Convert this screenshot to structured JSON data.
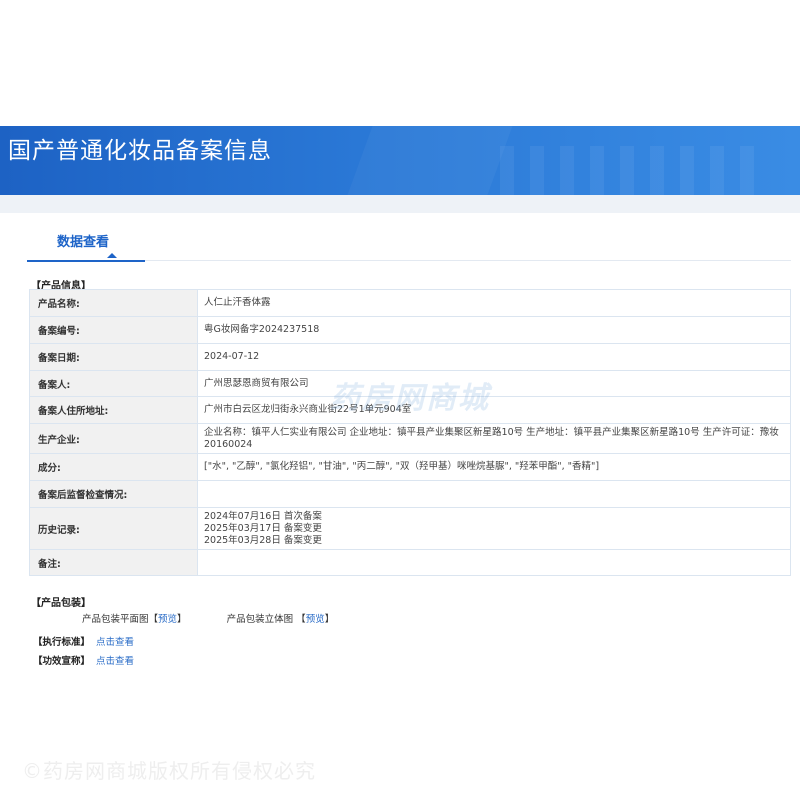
{
  "banner": {
    "title": "国产普通化妆品备案信息"
  },
  "tabs": {
    "active_label": "数据查看"
  },
  "product_info": {
    "section_label": "【产品信息】",
    "rows": [
      {
        "key": "产品名称:",
        "value": "人仁止汗香体露"
      },
      {
        "key": "备案编号:",
        "value": "粤G妆网备字2024237518"
      },
      {
        "key": "备案日期:",
        "value": "2024-07-12"
      },
      {
        "key": "备案人:",
        "value": "广州思瑟恩商贸有限公司"
      },
      {
        "key": "备案人住所地址:",
        "value": "广州市白云区龙归街永兴商业街22号1单元904室"
      },
      {
        "key": "生产企业:",
        "value": "企业名称：镇平人仁实业有限公司 企业地址：镇平县产业集聚区新星路10号 生产地址：镇平县产业集聚区新星路10号 生产许可证：豫妆20160024"
      },
      {
        "key": "成分:",
        "value": "[\"水\", \"乙醇\", \"氯化羟铝\", \"甘油\", \"丙二醇\", \"双（羟甲基）咪唑烷基脲\", \"羟苯甲酯\", \"香精\"]"
      },
      {
        "key": "备案后监督检查情况:",
        "value": ""
      },
      {
        "key": "历史记录:",
        "history": [
          "2024年07月16日 首次备案",
          "2025年03月17日 备案变更",
          "2025年03月28日 备案变更"
        ]
      },
      {
        "key": "备注:",
        "value": ""
      }
    ]
  },
  "packaging": {
    "section_label": "【产品包装】",
    "flat_label": "产品包装平面图",
    "flat_link": "预览",
    "solid_label": "产品包装立体图",
    "solid_link": "预览",
    "bracket_open": "【",
    "bracket_close": "】"
  },
  "standards": {
    "label": "【执行标准】",
    "link": "点击查看"
  },
  "efficacy": {
    "label": "【功效宣称】",
    "link": "点击查看"
  },
  "watermarks": {
    "center": "药房网商城",
    "bottom": "©药房网商城版权所有侵权必究"
  }
}
